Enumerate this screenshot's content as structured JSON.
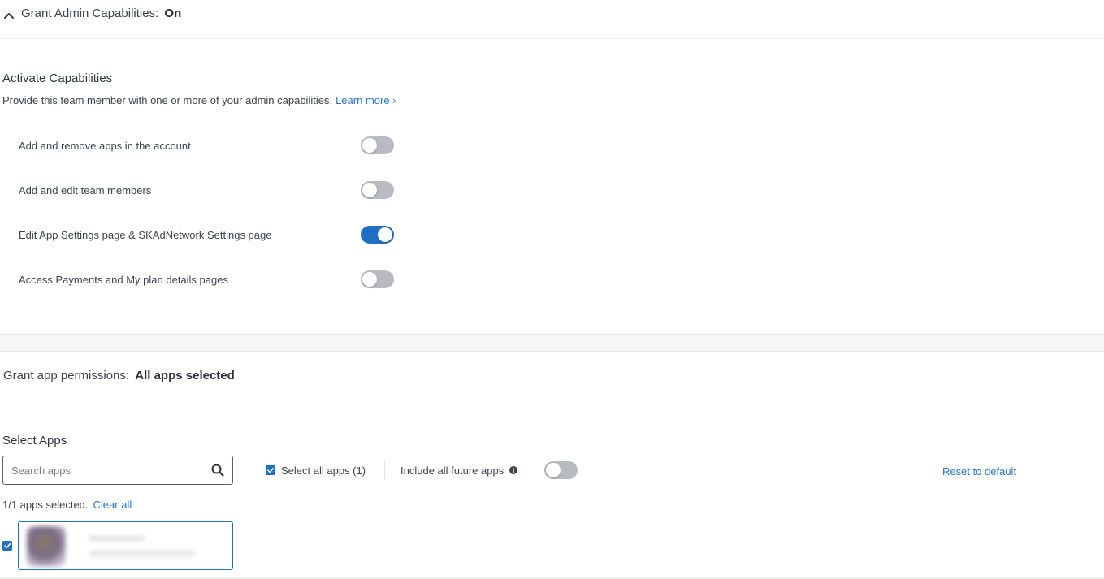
{
  "admin_capabilities": {
    "header_label": "Grant Admin Capabilities:",
    "header_state": "On",
    "section_title": "Activate Capabilities",
    "description": "Provide this team member with one or more of your admin capabilities.",
    "learn_more": "Learn more ›",
    "items": [
      {
        "label": "Add and remove apps in the account",
        "enabled": false
      },
      {
        "label": "Add and edit team members",
        "enabled": false
      },
      {
        "label": "Edit App Settings page & SKAdNetwork Settings page",
        "enabled": true
      },
      {
        "label": "Access Payments and My plan details pages",
        "enabled": false
      }
    ]
  },
  "app_permissions": {
    "header_label": "Grant app permissions:",
    "header_state": "All apps selected",
    "section_title": "Select Apps",
    "search": {
      "placeholder": "Search apps",
      "value": ""
    },
    "select_all_label": "Select all apps (1)",
    "select_all_checked": true,
    "future_apps_label": "Include all future apps",
    "future_apps_enabled": false,
    "reset_label": "Reset to default",
    "selected_count": "1/1 apps selected.",
    "clear_all": "Clear all",
    "apps": [
      {
        "checked": true
      }
    ]
  },
  "colors": {
    "accent": "#1f6fc5",
    "link": "#2b76c4",
    "toggle_off": "#b8bcc0"
  }
}
